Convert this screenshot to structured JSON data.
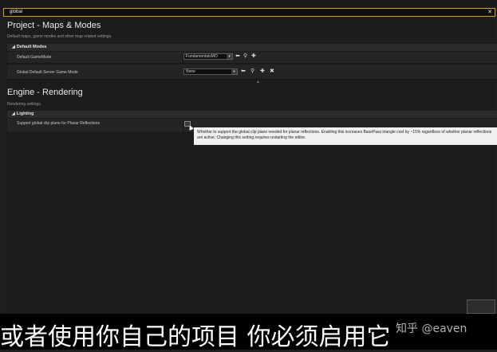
{
  "search": {
    "value": "global",
    "clear_icon": "close-icon"
  },
  "sections": [
    {
      "title": "Project - Maps & Modes",
      "description": "Default maps, game modes and other map related settings.",
      "category": "Default Modes",
      "rows": [
        {
          "label": "Default GameMode",
          "value": "FundamentalsMO"
        },
        {
          "label": "Global Default Server Game Mode",
          "value": "None"
        }
      ]
    },
    {
      "title": "Engine - Rendering",
      "description": "Rendering settings.",
      "category": "Lighting",
      "rows": [
        {
          "label": "Support global clip plane for Planar Reflections",
          "checked": false
        }
      ]
    }
  ],
  "tooltip": "Whether to support the global clip plane needed for planar reflections. Enabling this increases BasePass triangle cost by ~15% regardless of whether planar reflections are active. Changing this setting requires restarting the editor.",
  "caption": "或者使用你自己的项目 你必须启用它",
  "watermark": "知乎 @eaven",
  "icons": [
    "arrow-left-icon",
    "search-icon",
    "plus-icon",
    "close-icon"
  ]
}
